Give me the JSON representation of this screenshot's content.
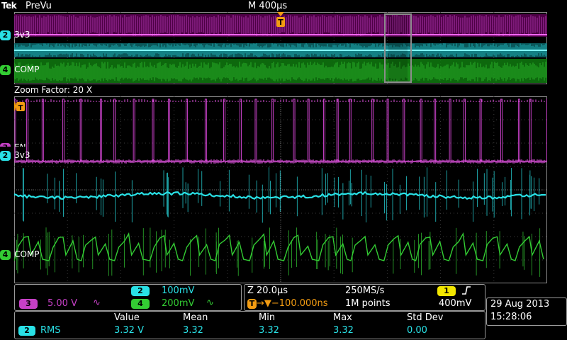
{
  "header": {
    "brand": "Tek",
    "mode": "PreVu",
    "timebase": "M 400µs"
  },
  "zoom": {
    "label": "Zoom Factor: 20 X"
  },
  "colors": {
    "ch1": "#f2e600",
    "ch2": "#29e1e6",
    "ch3": "#c640c6",
    "ch4": "#33cc33",
    "trigger": "#f39c12"
  },
  "overview": {
    "channels": [
      {
        "num": "2",
        "name": "3v3"
      },
      {
        "num": "4",
        "name": "COMP"
      }
    ]
  },
  "detail": {
    "channels": [
      {
        "num": "3",
        "name": "EN"
      },
      {
        "num": "2",
        "name": "3v3"
      },
      {
        "num": "4",
        "name": "COMP"
      }
    ]
  },
  "vertical": {
    "ch2": {
      "num": "2",
      "scale": "100mV"
    },
    "ch3": {
      "num": "3",
      "scale": "5.00 V"
    },
    "ch4": {
      "num": "4",
      "scale": "200mV"
    }
  },
  "horizontal": {
    "zoom_scale": "Z 20.0µs",
    "sample_rate": "250MS/s",
    "trigger_channel": "1",
    "trigger_level": "400mV",
    "trigger_position": "→▼−100.000ns",
    "record_length": "1M points"
  },
  "datetime": {
    "date": "29 Aug 2013",
    "time": "15:28:06"
  },
  "measurements": {
    "headers": [
      "Value",
      "Mean",
      "Min",
      "Max",
      "Std Dev"
    ],
    "row": {
      "channel": "2",
      "type": "RMS",
      "values": [
        "3.32 V",
        "3.32",
        "3.32",
        "3.32",
        "0.00"
      ]
    }
  }
}
